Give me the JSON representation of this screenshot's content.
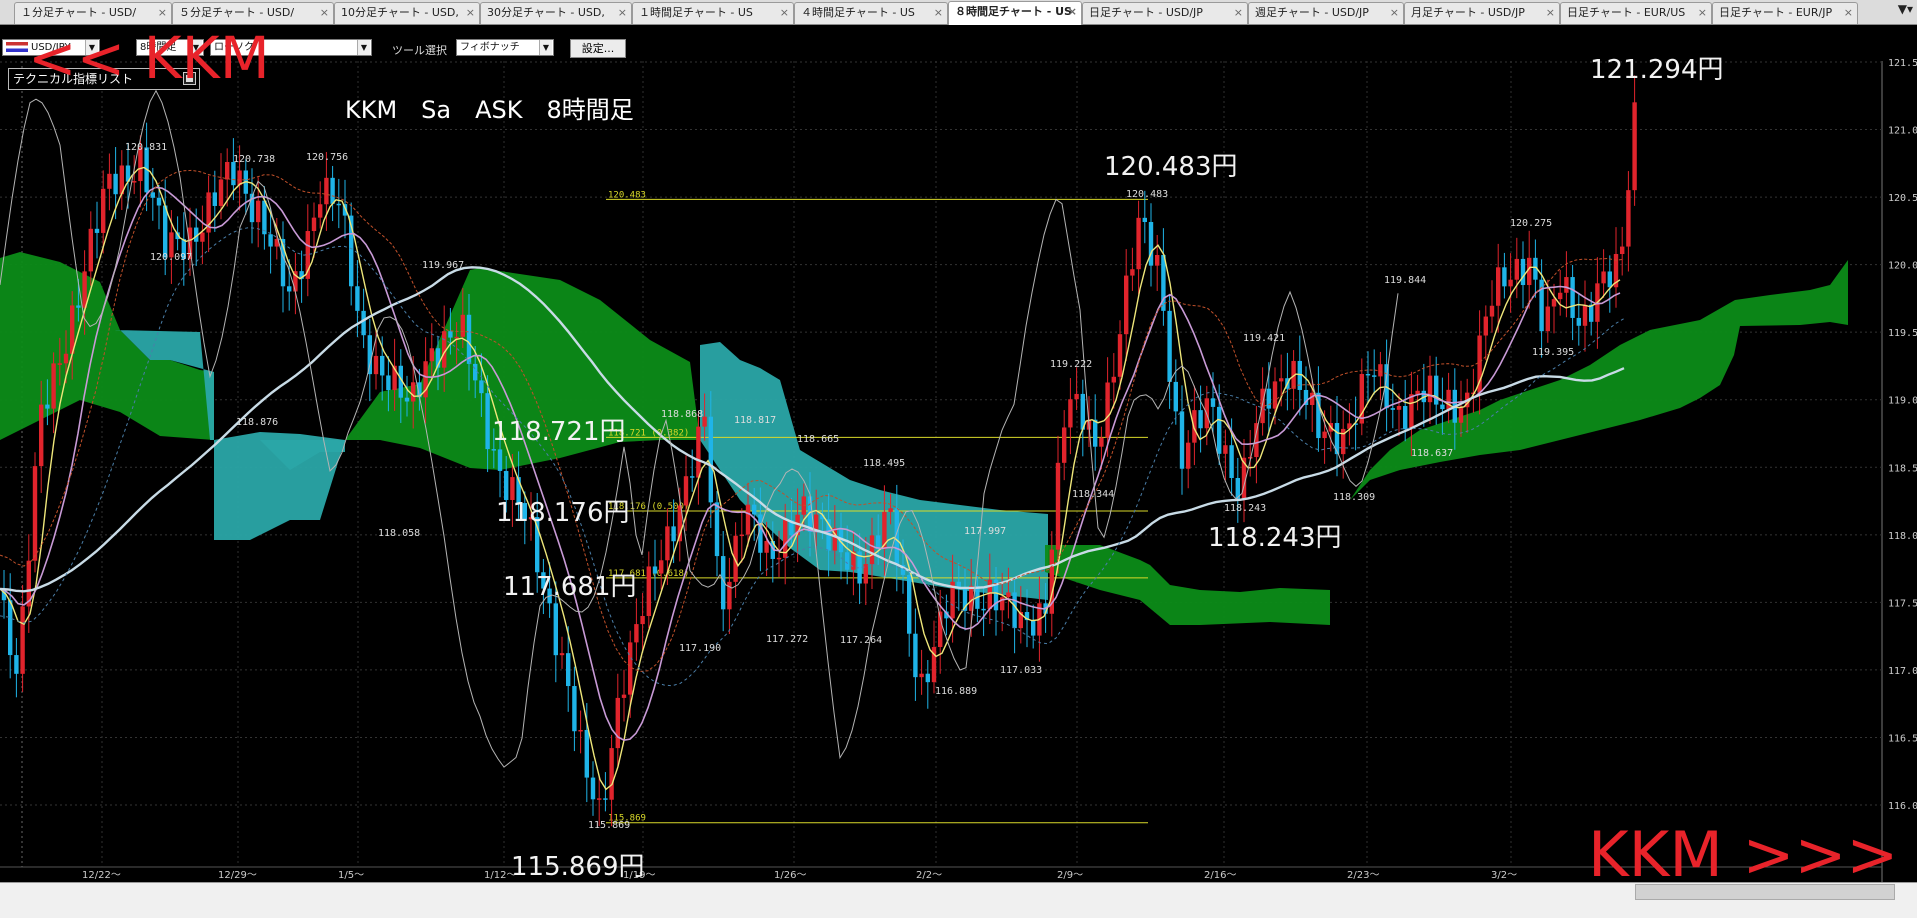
{
  "tabs": [
    {
      "label": "１分足チャート - USD/",
      "active": false
    },
    {
      "label": "５分足チャート - USD/",
      "active": false
    },
    {
      "label": "10分足チャート - USD,",
      "active": false
    },
    {
      "label": "30分足チャート - USD,",
      "active": false
    },
    {
      "label": "１時間足チャート - US",
      "active": false
    },
    {
      "label": "４時間足チャート - US",
      "active": false
    },
    {
      "label": "８時間足チャート - US",
      "active": true
    },
    {
      "label": "日足チャート - USD/JP",
      "active": false
    },
    {
      "label": "週足チャート - USD/JP",
      "active": false
    },
    {
      "label": "月足チャート - USD/JP",
      "active": false
    },
    {
      "label": "日足チャート - EUR/US",
      "active": false
    },
    {
      "label": "日足チャート - EUR/JP",
      "active": false
    }
  ],
  "tab_close": "×",
  "tab_menu": "▼▾",
  "toolbar": {
    "pair_select": "USD/JPY",
    "timeframe_select": "8時間足",
    "chart_type_select": "ローソク",
    "tool_label": "ツール選択",
    "tool_select": "フィボナッチ",
    "settings_button": "設定..."
  },
  "indicator_panel": {
    "title": "テクニカル指標リスト"
  },
  "chart": {
    "title": "KKM　Sa　ASK　8時間足",
    "watermark_left": "<< KKM",
    "watermark_right": "KKM >>>",
    "callouts": [
      "121.294円",
      "120.483円",
      "118.721円",
      "118.176円",
      "117.681円",
      "118.243円",
      "115.869円"
    ],
    "fib_labels": [
      "120.483",
      "118.721 (0.382)",
      "118.176 (0.500)",
      "117.681 (0.618)",
      "115.869"
    ],
    "price_labels": [
      "120.831",
      "120.738",
      "120.756",
      "120.097",
      "119.967",
      "118.876",
      "118.058",
      "118.868",
      "118.817",
      "118.665",
      "118.495",
      "117.997",
      "117.272",
      "117.264",
      "117.190",
      "116.889",
      "117.033",
      "115.869",
      "119.222",
      "118.344",
      "120.483",
      "119.421",
      "118.243",
      "118.309",
      "119.844",
      "118.637",
      "120.275",
      "119.395"
    ],
    "y_axis": [
      "121.50",
      "121.00",
      "120.50",
      "120.00",
      "119.50",
      "119.00",
      "118.50",
      "118.00",
      "117.50",
      "117.00",
      "116.50",
      "116.00"
    ],
    "x_axis": [
      "12/22〜",
      "12/29〜",
      "1/5〜",
      "1/12〜",
      "1/19〜",
      "1/26〜",
      "2/2〜",
      "2/9〜",
      "2/16〜",
      "2/23〜",
      "3/2〜"
    ],
    "colors": {
      "up": "#e0242c",
      "down": "#1fb4e8",
      "fib": "#d9d92a",
      "cloud_bull": "#0c8c18",
      "cloud_bear": "#2aa7a8",
      "ma_long": "#c8dbe6",
      "ma_mid": "#c89ad6",
      "tenkan": "#eee67a",
      "chikou": "#b4b4b4",
      "watermark": "#e8232a"
    }
  }
}
